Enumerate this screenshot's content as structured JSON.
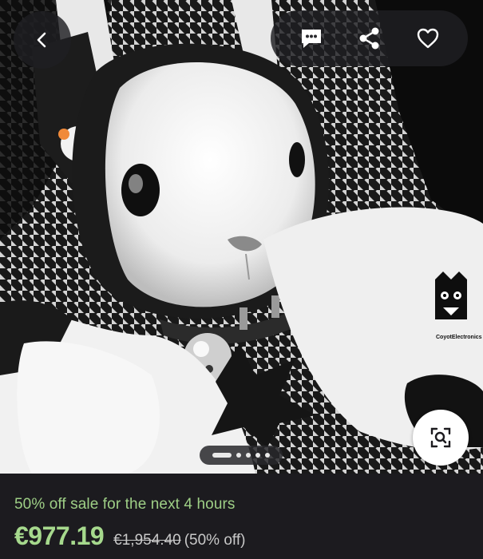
{
  "nav": {
    "back_icon": "chevron-left-icon",
    "actions": [
      "message-icon",
      "share-icon",
      "heart-icon"
    ]
  },
  "gallery": {
    "page_count": 5,
    "active_index": 0,
    "watermark_text": "CoyotElectronics",
    "zoom_icon": "image-search-icon"
  },
  "listing": {
    "sale_text": "50% off sale for the next  4 hours",
    "price": "€977.19",
    "original_price": "€1,954.40",
    "discount": "(50% off)"
  },
  "colors": {
    "accent_green": "#a6d98d",
    "background": "#1c1b1f"
  }
}
